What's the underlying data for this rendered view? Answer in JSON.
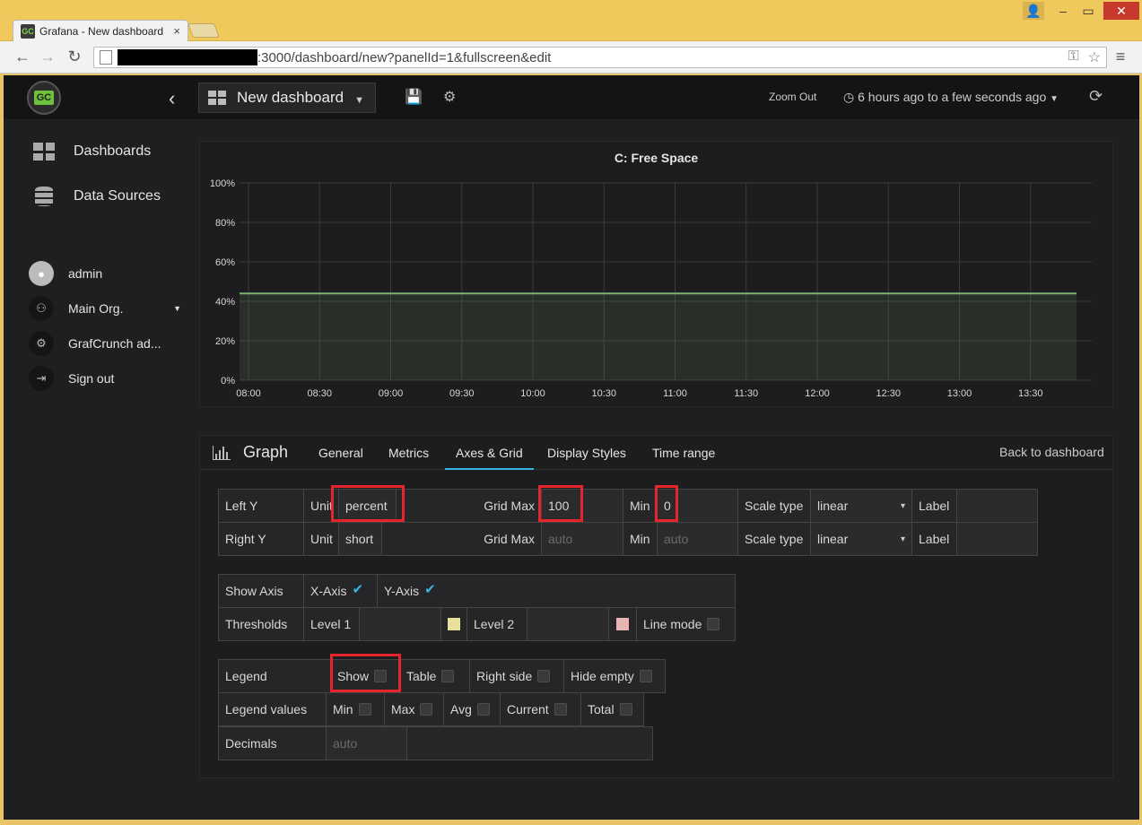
{
  "browser": {
    "tab_title": "Grafana - New dashboard",
    "tab_favicon": "GC",
    "url_path": ":3000/dashboard/new?panelId=1&fullscreen&edit"
  },
  "topnav": {
    "logo_text": "GC",
    "dashboard_title": "New dashboard",
    "zoom_out": "Zoom Out",
    "time_range": "6 hours ago to a few seconds ago"
  },
  "sidemenu": {
    "dashboards": "Dashboards",
    "data_sources": "Data Sources",
    "user": "admin",
    "org": "Main Org.",
    "grafcrunch": "GrafCrunch ad...",
    "sign_out": "Sign out"
  },
  "panel": {
    "title": "C: Free Space"
  },
  "chart_data": {
    "type": "area",
    "title": "C: Free Space",
    "x": [
      "08:00",
      "08:30",
      "09:00",
      "09:30",
      "10:00",
      "10:30",
      "11:00",
      "11:30",
      "12:00",
      "12:30",
      "13:00",
      "13:30"
    ],
    "series": [
      {
        "values": [
          44,
          44,
          44,
          44,
          44,
          44,
          44,
          44,
          44,
          44,
          44,
          44
        ]
      }
    ],
    "y_ticks": [
      "0%",
      "20%",
      "40%",
      "60%",
      "80%",
      "100%"
    ],
    "ylim": [
      0,
      100
    ],
    "grid": true,
    "series_color": "#7eb26d"
  },
  "editor": {
    "section": "Graph",
    "tabs": [
      "General",
      "Metrics",
      "Axes & Grid",
      "Display Styles",
      "Time range"
    ],
    "active_tab": "Axes & Grid",
    "back": "Back to dashboard",
    "left_y": {
      "label": "Left Y",
      "unit_label": "Unit",
      "unit": "percent",
      "grid_max_label": "Grid Max",
      "grid_max": "100",
      "min_label": "Min",
      "min": "0",
      "scale_label": "Scale type",
      "scale": "linear",
      "label_label": "Label"
    },
    "right_y": {
      "label": "Right Y",
      "unit_label": "Unit",
      "unit": "short",
      "grid_max_label": "Grid Max",
      "grid_max_ph": "auto",
      "min_label": "Min",
      "min_ph": "auto",
      "scale_label": "Scale type",
      "scale": "linear",
      "label_label": "Label"
    },
    "show_axis": {
      "label": "Show Axis",
      "x": "X-Axis",
      "y": "Y-Axis"
    },
    "thresholds": {
      "label": "Thresholds",
      "level1": "Level 1",
      "level2": "Level 2",
      "line_mode": "Line mode"
    },
    "legend": {
      "label": "Legend",
      "show": "Show",
      "table": "Table",
      "right_side": "Right side",
      "hide_empty": "Hide empty"
    },
    "legend_values": {
      "label": "Legend values",
      "min": "Min",
      "max": "Max",
      "avg": "Avg",
      "current": "Current",
      "total": "Total"
    },
    "decimals": {
      "label": "Decimals",
      "ph": "auto"
    }
  }
}
